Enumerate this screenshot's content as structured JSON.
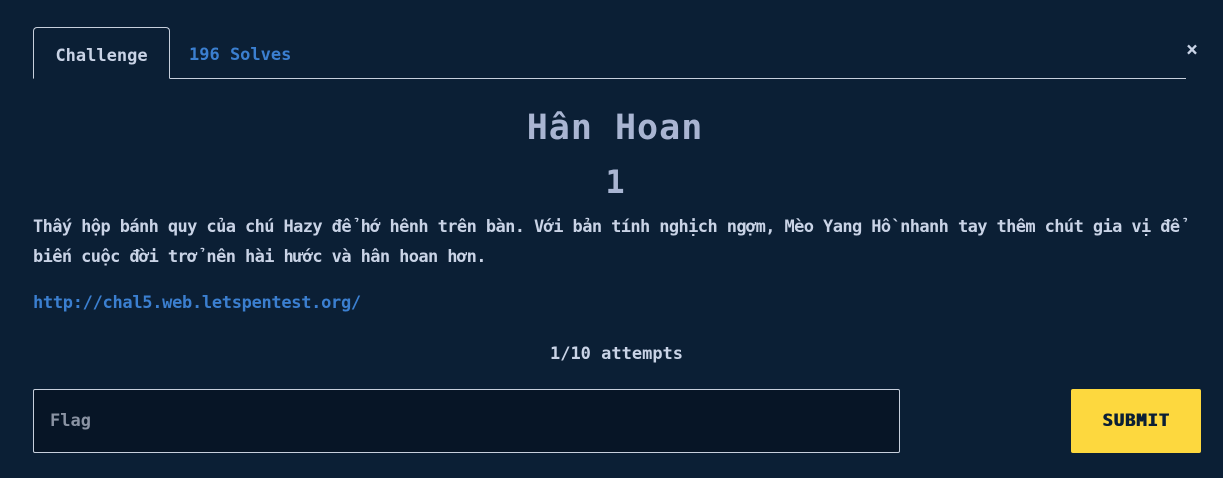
{
  "tabs": {
    "challenge_label": "Challenge",
    "solves_label": "196 Solves"
  },
  "close_symbol": "×",
  "challenge": {
    "title": "Hân Hoan",
    "points": "1",
    "description": "Thấy hộp bánh quy của chú Hazy để hớ hênh trên bàn. Với bản tính nghịch ngợm, Mèo Yang Hồ nhanh tay thêm chút gia vị để biến cuộc đời trở nên hài hước và hân hoan hơn.",
    "link": "http://chal5.web.letspentest.org/",
    "attempts": "1/10 attempts"
  },
  "form": {
    "flag_placeholder": "Flag",
    "flag_value": "",
    "submit_label": "SUBMIT"
  },
  "colors": {
    "background": "#0b1f35",
    "accent_link": "#3b7fd0",
    "submit_bg": "#fdd83e",
    "title": "#a9b5d2"
  },
  "icons": {
    "close": "close-icon"
  }
}
